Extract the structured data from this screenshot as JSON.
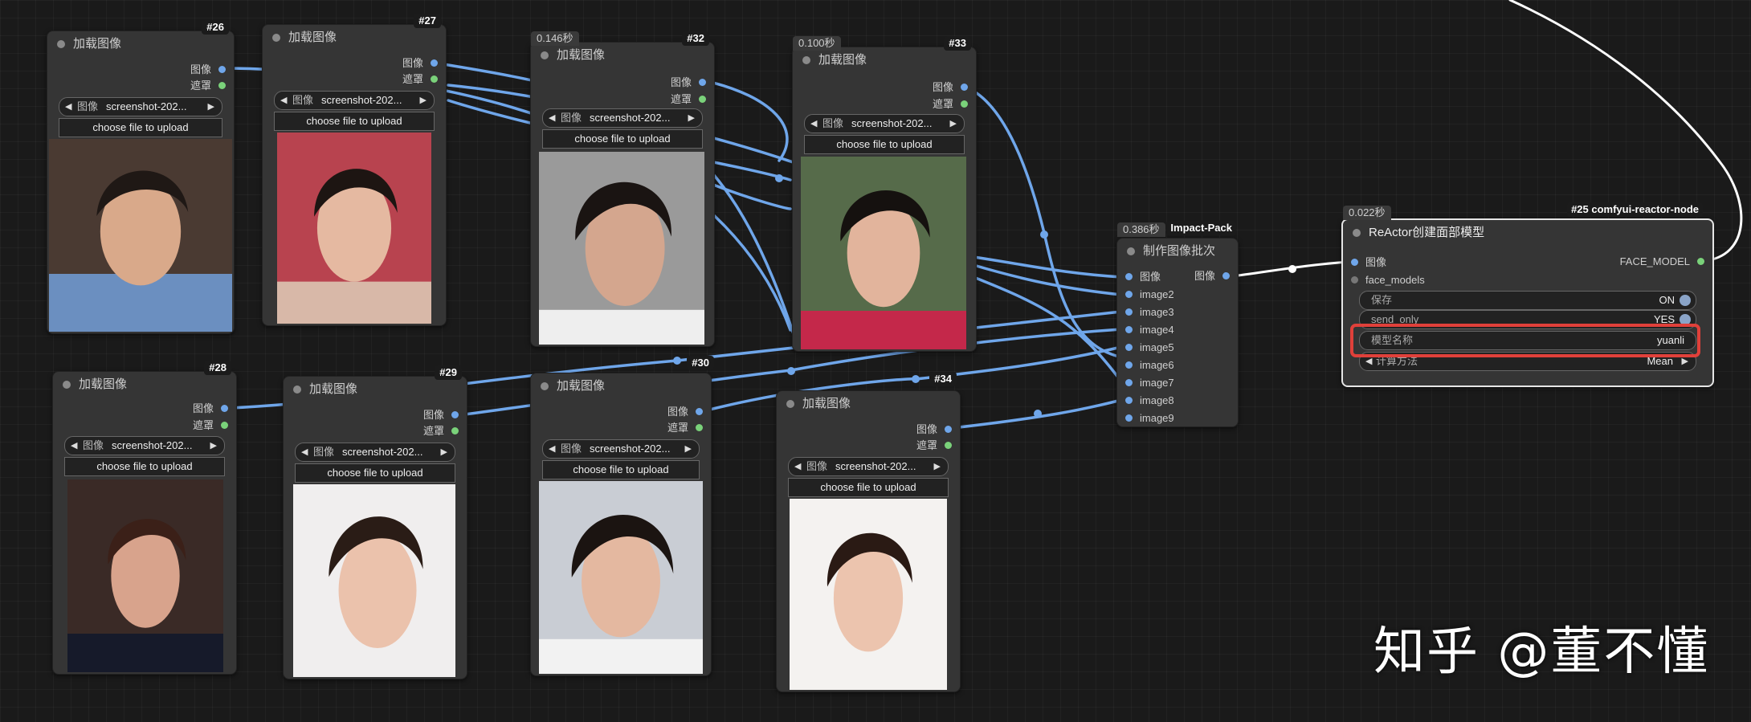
{
  "colors": {
    "image_port": "#6fa6ea",
    "mask_port": "#7ad27a",
    "link": "#6fa6ea",
    "link_white": "#ffffff",
    "highlight": "#e0403a"
  },
  "load_image": {
    "title": "加载图像",
    "out_image": "图像",
    "out_mask": "遮罩",
    "combo_label": "图像",
    "combo_value": "screenshot-202...",
    "upload_label": "choose file to upload"
  },
  "nodes": [
    {
      "id": "#26"
    },
    {
      "id": "#27"
    },
    {
      "id": "#32",
      "time": "0.146秒"
    },
    {
      "id": "#33",
      "time": "0.100秒"
    },
    {
      "id": "#28"
    },
    {
      "id": "#29"
    },
    {
      "id": "#30"
    },
    {
      "id": "#34"
    }
  ],
  "batch_node": {
    "time": "0.386秒",
    "pack": "Impact-Pack",
    "title": "制作图像批次",
    "output": "图像",
    "inputs": [
      "图像",
      "image2",
      "image3",
      "image4",
      "image5",
      "image6",
      "image7",
      "image8",
      "image9"
    ]
  },
  "reactor_node": {
    "time": "0.022秒",
    "id_label": "#25 comfyui-reactor-node",
    "title": "ReActor创建面部模型",
    "inputs": [
      "图像",
      "face_models"
    ],
    "output": "FACE_MODEL",
    "widgets": {
      "save": {
        "label": "保存",
        "value": "ON"
      },
      "send_only": {
        "label": "send_only",
        "value": "YES"
      },
      "model_name": {
        "label": "模型名称",
        "value": "yuanli"
      },
      "compute": {
        "label": "计算方法",
        "value": "Mean"
      }
    }
  },
  "watermark": "知乎 @董不懂"
}
